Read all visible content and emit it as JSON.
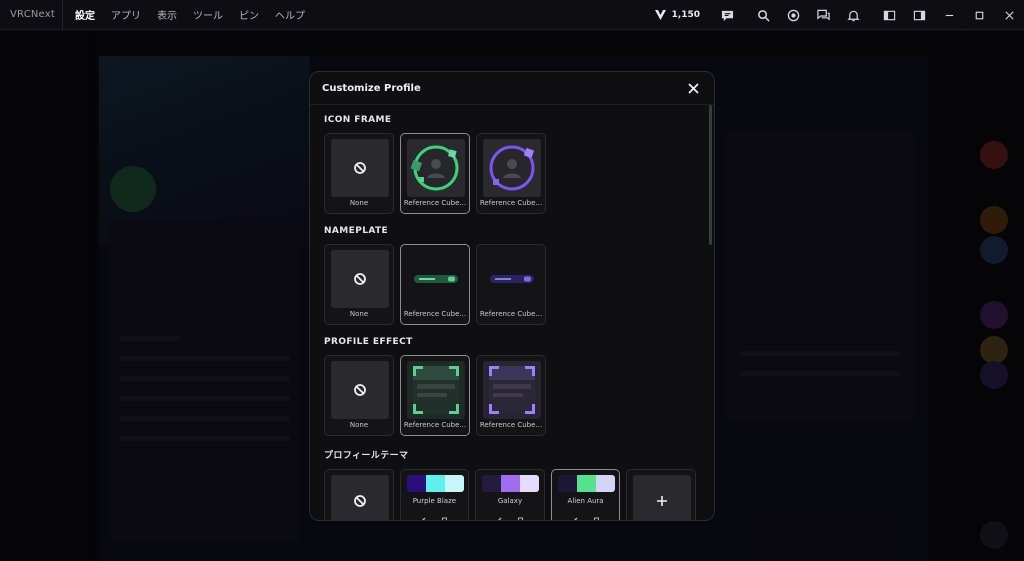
{
  "app": {
    "title": "VRCNext"
  },
  "menu": [
    "設定",
    "アプリ",
    "表示",
    "ツール",
    "ピン",
    "ヘルプ"
  ],
  "credits": {
    "value": "1,150"
  },
  "modal": {
    "title": "Customize Profile",
    "sections": {
      "icon_frame": {
        "title": "ICON FRAME",
        "items": [
          {
            "label": "None"
          },
          {
            "label": "Reference Cube..."
          },
          {
            "label": "Reference Cube..."
          }
        ]
      },
      "nameplate": {
        "title": "NAMEPLATE",
        "items": [
          {
            "label": "None"
          },
          {
            "label": "Reference Cube..."
          },
          {
            "label": "Reference Cube..."
          }
        ]
      },
      "profile_effect": {
        "title": "PROFILE EFFECT",
        "items": [
          {
            "label": "None"
          },
          {
            "label": "Reference Cube..."
          },
          {
            "label": "Reference Cube..."
          }
        ]
      },
      "profile_theme": {
        "title": "プロフィールテーマ",
        "themes": [
          {
            "name": "Purple Blaze",
            "colors": [
              "#2a0f7a",
              "#5ff0f0",
              "#c6f6fa"
            ]
          },
          {
            "name": "Galaxy",
            "colors": [
              "#241c3c",
              "#a06cf0",
              "#e4dcfa"
            ]
          },
          {
            "name": "Alien Aura",
            "colors": [
              "#1e1638",
              "#56e28c",
              "#d4d4f6"
            ]
          }
        ]
      }
    }
  },
  "colors": {
    "accent_green": "#3fd07a",
    "accent_purple": "#7a55f0"
  }
}
